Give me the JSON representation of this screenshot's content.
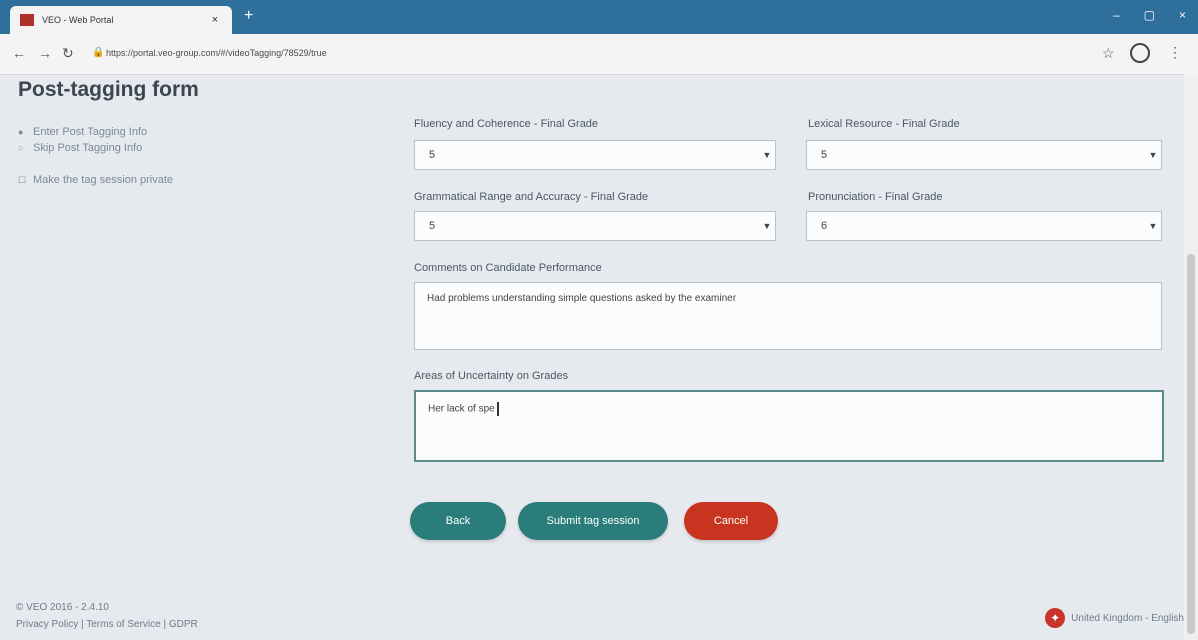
{
  "browser": {
    "tab_title": "VEO - Web Portal",
    "tab_close": "×",
    "new_tab": "+",
    "url": "https://portal.veo-group.com/#/videoTagging/78529/true",
    "win_minimize": "–",
    "win_restore": "▢",
    "win_close": "×"
  },
  "page": {
    "title": "Post-tagging form",
    "options": [
      {
        "label": "Enter Post Tagging Info",
        "mark": "●"
      },
      {
        "label": "Skip Post Tagging Info",
        "mark": "○"
      },
      {
        "label": "Make the tag session private",
        "mark": "☐"
      }
    ]
  },
  "form": {
    "fluency": {
      "label": "Fluency and Coherence - Final Grade",
      "value": "5"
    },
    "lexical": {
      "label": "Lexical Resource - Final Grade",
      "value": "5"
    },
    "grammar": {
      "label": "Grammatical Range and Accuracy - Final Grade",
      "value": "5"
    },
    "pronunciation": {
      "label": "Pronunciation - Final Grade",
      "value": "6"
    },
    "comments": {
      "label": "Comments on Candidate Performance",
      "value": "Had problems understanding simple questions asked by the examiner"
    },
    "uncertainty": {
      "label": "Areas of Uncertainty on Grades",
      "value": "Her lack of spe"
    }
  },
  "buttons": {
    "back": "Back",
    "submit": "Submit tag session",
    "cancel": "Cancel"
  },
  "footer": {
    "copyright": "© VEO 2016 - 2.4.10",
    "privacy": "Privacy Policy",
    "terms": "Terms of Service",
    "gdpr": "GDPR",
    "separator": "|",
    "locale": "United Kingdom - English"
  },
  "colors": {
    "teal": "#2a7d7a",
    "red": "#c8341f",
    "chrome_blue": "#2f6f9c"
  }
}
